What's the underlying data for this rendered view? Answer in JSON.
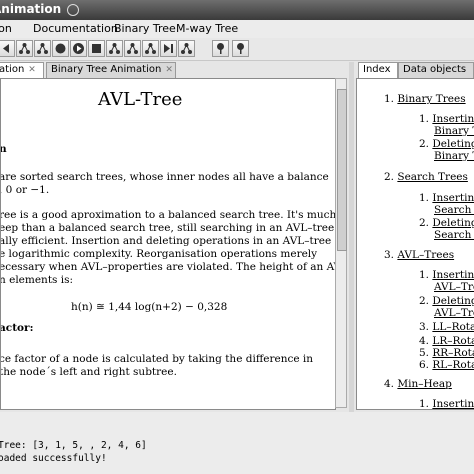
{
  "window": {
    "title": "Animation"
  },
  "menu": {
    "items": [
      "ation",
      "Documentation",
      "Binary Tree",
      "M-way Tree"
    ]
  },
  "toolbar": {
    "buttons": [
      "back-step-icon",
      "tree-icon",
      "tree-icon",
      "record-icon",
      "play-icon",
      "stop-icon",
      "tree-icon",
      "tree-icon",
      "tree-icon",
      "skip-icon",
      "tree-icon",
      "pin-icon",
      "pin-icon"
    ]
  },
  "left_tabs": [
    {
      "label": "ation"
    },
    {
      "label": "Binary Tree Animation"
    }
  ],
  "right_tabs": [
    {
      "label": "Index"
    },
    {
      "label": "Data objects"
    }
  ],
  "doc": {
    "title": "AVL-Tree",
    "heading1": "n",
    "lines1": [
      "are sorted search trees, whose inner nodes all have a balance",
      ", 0 or −1."
    ],
    "lines2": [
      "ree is a good aproximation to a balanced search tree. It's much",
      "eep than a balanced search tree, still searching in an AVL–tree is",
      "ally efficient. Insertion and deleting operations in an AVL–tree",
      "e logarithmic complexity. Reorganisation operations merely",
      "ecessary when AVL–properties are violated. The height of an AVL–",
      "n elements is:"
    ],
    "formula": "h(n) ≅ 1,44 log(n+2) − 0,328",
    "heading2": "actor:",
    "lines3": [
      "ce factor of a node is calculated by taking the difference in",
      "the node´s left and right subtree."
    ]
  },
  "index": {
    "sections": [
      {
        "num": "1.",
        "label": "Binary Trees",
        "subs": [
          {
            "num": "1.",
            "lines": [
              "Insertin",
              "Binary T"
            ]
          },
          {
            "num": "2.",
            "lines": [
              "Deleting",
              "Binary T"
            ]
          }
        ]
      },
      {
        "num": "2.",
        "label": "Search Trees",
        "subs": [
          {
            "num": "1.",
            "lines": [
              "Insertin",
              "Search T"
            ]
          },
          {
            "num": "2.",
            "lines": [
              "Deleting",
              "Search T"
            ]
          }
        ]
      },
      {
        "num": "3.",
        "label": "AVL–Trees",
        "subs": [
          {
            "num": "1.",
            "lines": [
              "Insertin",
              "AVL–Tre"
            ]
          },
          {
            "num": "2.",
            "lines": [
              "Deleting",
              "AVL–Tre"
            ]
          },
          {
            "num": "3.",
            "lines": [
              "LL–Rota"
            ]
          },
          {
            "num": "4.",
            "lines": [
              "LR–Rota"
            ]
          },
          {
            "num": "5.",
            "lines": [
              "RR–Rota"
            ]
          },
          {
            "num": "6.",
            "lines": [
              "RL–Rota"
            ]
          }
        ]
      },
      {
        "num": "4.",
        "label": "Min–Heap",
        "subs": [
          {
            "num": "1.",
            "lines": [
              "Insertin"
            ]
          }
        ]
      }
    ]
  },
  "status": {
    "lines": [
      "Tree: [3, 1, 5, , 2, 4, 6]",
      "oaded successfully!"
    ]
  }
}
